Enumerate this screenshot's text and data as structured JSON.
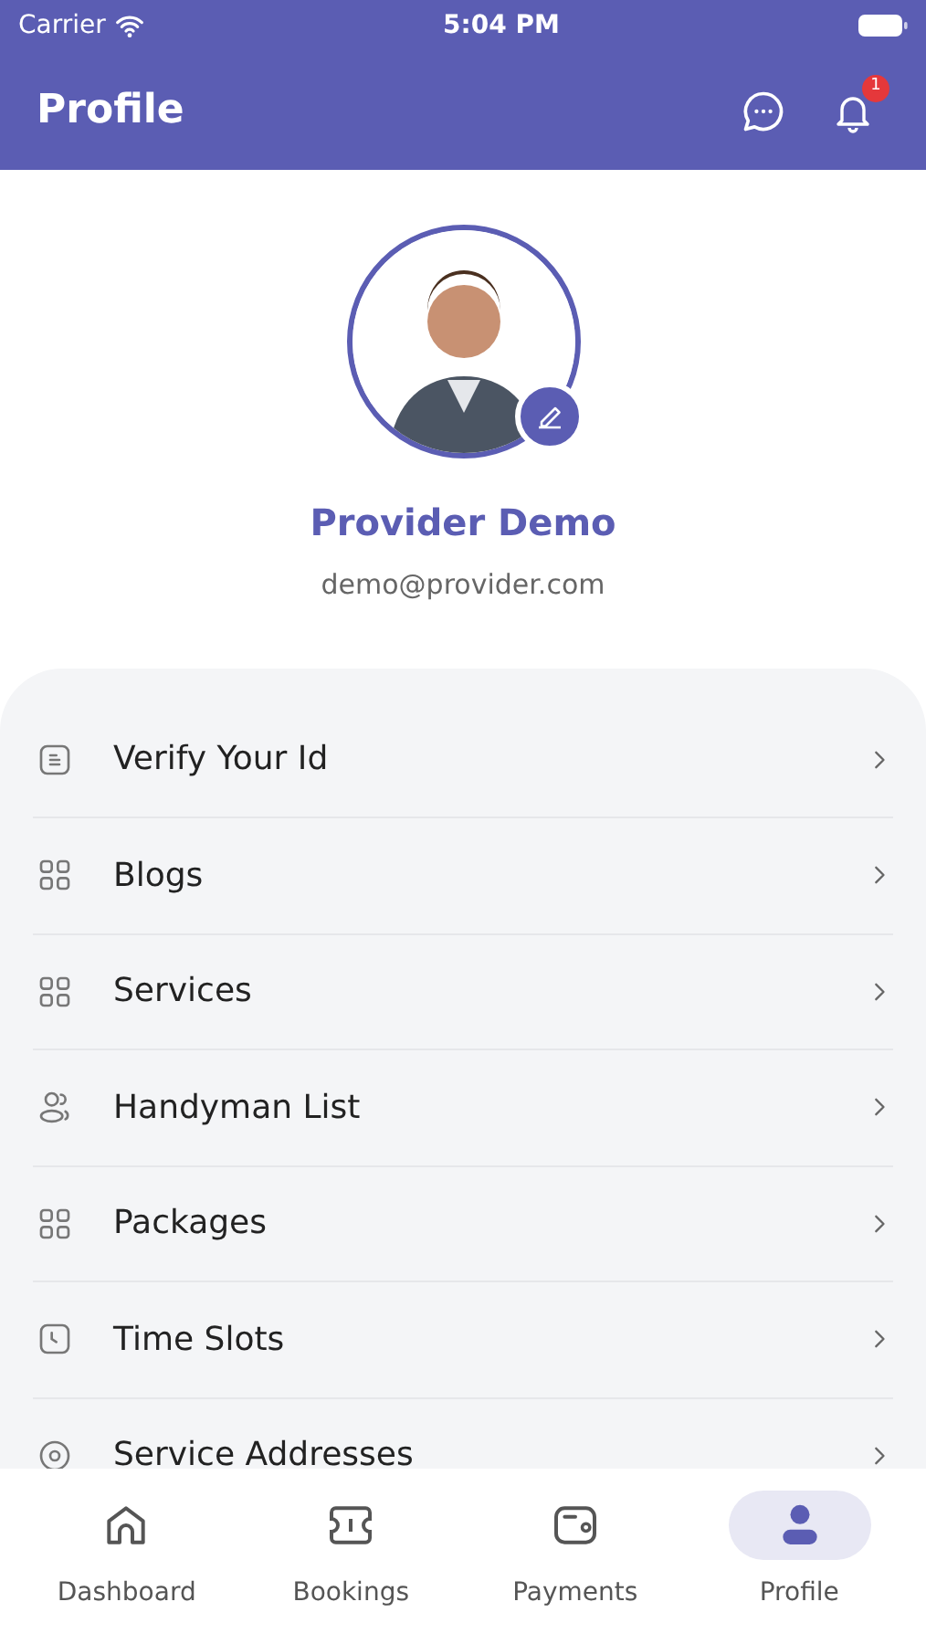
{
  "status_bar": {
    "carrier": "Carrier",
    "time": "5:04 PM"
  },
  "header": {
    "title": "Profile",
    "notification_count": "1"
  },
  "profile": {
    "name": "Provider Demo",
    "email": "demo@provider.com"
  },
  "menu": [
    {
      "label": "Verify Your Id",
      "kind": "document"
    },
    {
      "label": "Blogs",
      "kind": "grid"
    },
    {
      "label": "Services",
      "kind": "grid"
    },
    {
      "label": "Handyman List",
      "kind": "users"
    },
    {
      "label": "Packages",
      "kind": "grid"
    },
    {
      "label": "Time Slots",
      "kind": "clock"
    },
    {
      "label": "Service Addresses",
      "kind": "pin"
    }
  ],
  "tabs": [
    {
      "label": "Dashboard",
      "kind": "home",
      "selected": false
    },
    {
      "label": "Bookings",
      "kind": "ticket",
      "selected": false
    },
    {
      "label": "Payments",
      "kind": "wallet",
      "selected": false
    },
    {
      "label": "Profile",
      "kind": "person",
      "selected": true
    }
  ]
}
